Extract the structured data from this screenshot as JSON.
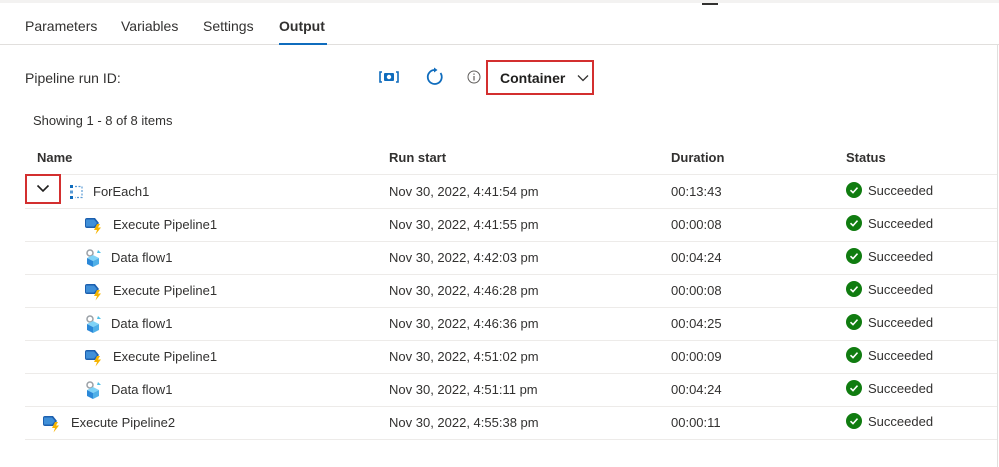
{
  "tabs": [
    {
      "label": "Parameters"
    },
    {
      "label": "Variables"
    },
    {
      "label": "Settings"
    },
    {
      "label": "Output",
      "active": true
    }
  ],
  "toolbar": {
    "run_id_label": "Pipeline run ID:",
    "container_label": "Container"
  },
  "showing_text": "Showing 1 - 8 of 8 items",
  "columns": {
    "name": "Name",
    "run_start": "Run start",
    "duration": "Duration",
    "status": "Status"
  },
  "rows": [
    {
      "name": "ForEach1",
      "run_start": "Nov 30, 2022, 4:41:54 pm",
      "duration": "00:13:43",
      "status": "Succeeded",
      "icon": "foreach-icon",
      "level": 0,
      "expandable": true
    },
    {
      "name": "Execute Pipeline1",
      "run_start": "Nov 30, 2022, 4:41:55 pm",
      "duration": "00:00:08",
      "status": "Succeeded",
      "icon": "execute-pipeline-icon",
      "level": 1
    },
    {
      "name": "Data flow1",
      "run_start": "Nov 30, 2022, 4:42:03 pm",
      "duration": "00:04:24",
      "status": "Succeeded",
      "icon": "data-flow-icon",
      "level": 1
    },
    {
      "name": "Execute Pipeline1",
      "run_start": "Nov 30, 2022, 4:46:28 pm",
      "duration": "00:00:08",
      "status": "Succeeded",
      "icon": "execute-pipeline-icon",
      "level": 1
    },
    {
      "name": "Data flow1",
      "run_start": "Nov 30, 2022, 4:46:36 pm",
      "duration": "00:04:25",
      "status": "Succeeded",
      "icon": "data-flow-icon",
      "level": 1
    },
    {
      "name": "Execute Pipeline1",
      "run_start": "Nov 30, 2022, 4:51:02 pm",
      "duration": "00:00:09",
      "status": "Succeeded",
      "icon": "execute-pipeline-icon",
      "level": 1
    },
    {
      "name": "Data flow1",
      "run_start": "Nov 30, 2022, 4:51:11 pm",
      "duration": "00:04:24",
      "status": "Succeeded",
      "icon": "data-flow-icon",
      "level": 1
    },
    {
      "name": "Execute Pipeline2",
      "run_start": "Nov 30, 2022, 4:55:38 pm",
      "duration": "00:00:11",
      "status": "Succeeded",
      "icon": "execute-pipeline-icon",
      "level": 0
    }
  ],
  "colors": {
    "accent": "#0f6cbd",
    "success": "#107c10",
    "highlight_border": "#d32f2f"
  }
}
